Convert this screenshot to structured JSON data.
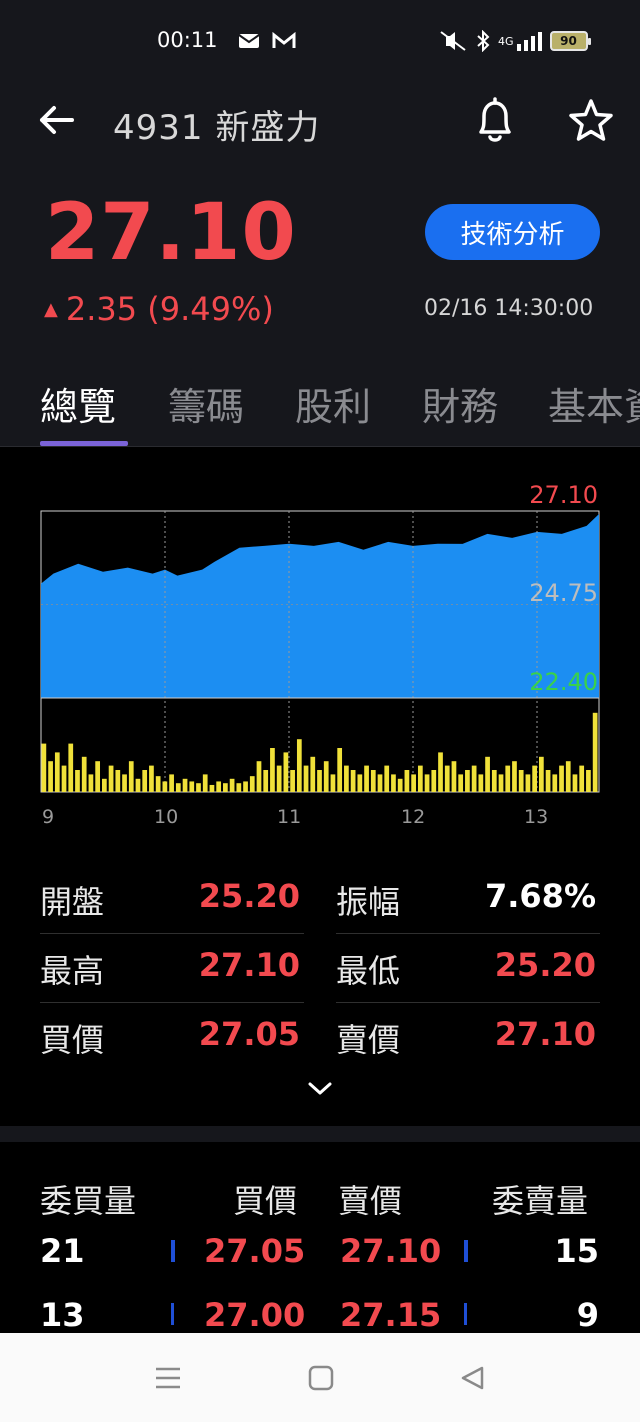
{
  "status_bar": {
    "time": "00:11",
    "network": "4G",
    "battery": "90",
    "icons": [
      "mail-icon",
      "gmail-icon",
      "mute-icon",
      "bluetooth-icon",
      "signal-icon",
      "battery-icon"
    ]
  },
  "header": {
    "title": "4931 新盛力",
    "back_icon": "back-arrow-icon",
    "bell_icon": "bell-icon",
    "star_icon": "star-icon"
  },
  "quote": {
    "price": "27.10",
    "change": "2.35 (9.49%)",
    "change_symbol": "▲",
    "timestamp": "02/16 14:30:00",
    "technical_button": "技術分析",
    "up_color": "#f24a4f"
  },
  "tabs": [
    "總覽",
    "籌碼",
    "股利",
    "財務",
    "基本資"
  ],
  "chart_data": {
    "type": "area",
    "title": "",
    "x_ticks": [
      "9",
      "10",
      "11",
      "12",
      "13"
    ],
    "y_ticks": {
      "high": "27.10",
      "mid": "24.75",
      "low": "22.40"
    },
    "ylim": [
      22.4,
      27.1
    ],
    "series": [
      {
        "type": "area",
        "color": "#1c8ef2",
        "x": [
          9.0,
          9.1,
          9.3,
          9.5,
          9.7,
          9.9,
          10.0,
          10.1,
          10.3,
          10.4,
          10.6,
          10.8,
          11.0,
          11.2,
          11.4,
          11.6,
          11.8,
          12.0,
          12.2,
          12.4,
          12.6,
          12.8,
          13.0,
          13.2,
          13.4,
          13.5
        ],
        "values": [
          25.2,
          25.6,
          25.7,
          25.65,
          25.6,
          25.6,
          25.55,
          25.55,
          25.55,
          25.9,
          26.1,
          26.3,
          26.2,
          26.3,
          26.25,
          26.2,
          26.25,
          26.3,
          26.2,
          26.35,
          26.45,
          26.5,
          26.5,
          26.6,
          26.65,
          27.1
        ]
      },
      {
        "type": "bar",
        "color": "#f0e13a",
        "name": "volume",
        "values": [
          0.55,
          0.35,
          0.45,
          0.3,
          0.55,
          0.25,
          0.4,
          0.2,
          0.35,
          0.15,
          0.3,
          0.25,
          0.2,
          0.35,
          0.15,
          0.25,
          0.3,
          0.18,
          0.12,
          0.2,
          0.1,
          0.15,
          0.12,
          0.1,
          0.2,
          0.08,
          0.12,
          0.1,
          0.15,
          0.1,
          0.12,
          0.18,
          0.35,
          0.25,
          0.5,
          0.3,
          0.45,
          0.25,
          0.6,
          0.3,
          0.4,
          0.25,
          0.35,
          0.2,
          0.5,
          0.3,
          0.25,
          0.2,
          0.3,
          0.25,
          0.2,
          0.3,
          0.2,
          0.15,
          0.25,
          0.2,
          0.3,
          0.2,
          0.25,
          0.45,
          0.3,
          0.35,
          0.2,
          0.25,
          0.3,
          0.2,
          0.4,
          0.25,
          0.2,
          0.3,
          0.35,
          0.25,
          0.2,
          0.3,
          0.4,
          0.25,
          0.2,
          0.3,
          0.35,
          0.2,
          0.3,
          0.25,
          0.9
        ]
      }
    ],
    "colors": {
      "high_label": "#f24a4f",
      "mid_label": "#bdbdbd",
      "low_label": "#3ad14a"
    }
  },
  "stats": {
    "left": [
      {
        "label": "開盤",
        "value": "25.20"
      },
      {
        "label": "最高",
        "value": "27.10"
      },
      {
        "label": "買價",
        "value": "27.05"
      }
    ],
    "right": [
      {
        "label": "振幅",
        "value": "7.68%"
      },
      {
        "label": "最低",
        "value": "25.20"
      },
      {
        "label": "賣價",
        "value": "27.10"
      }
    ],
    "expand_icon": "chevron-down-icon"
  },
  "order_book": {
    "headers": [
      "委買量",
      "買價",
      "賣價",
      "委賣量"
    ],
    "rows": [
      {
        "bid_qty": "21",
        "bid": "27.05",
        "ask": "27.10",
        "ask_qty": "15"
      },
      {
        "bid_qty": "13",
        "bid": "27.00",
        "ask": "27.15",
        "ask_qty": "9"
      }
    ]
  },
  "nav": [
    "menu-icon",
    "home-square-icon",
    "back-triangle-icon"
  ]
}
